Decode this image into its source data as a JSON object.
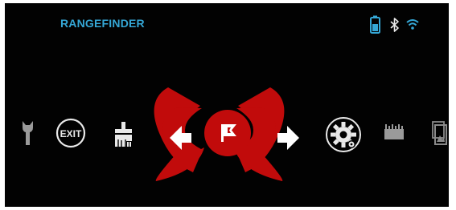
{
  "header": {
    "title": "RANGEFINDER",
    "status_icons": [
      "battery-icon",
      "bluetooth-icon",
      "wifi-icon"
    ]
  },
  "menu": {
    "items": [
      {
        "name": "wrench-icon"
      },
      {
        "name": "exit-button",
        "label": "EXIT"
      },
      {
        "name": "clear-brush-icon"
      },
      {
        "name": "arrow-left-icon"
      },
      {
        "name": "flag-icon",
        "selected": true
      },
      {
        "name": "arrow-right-icon"
      },
      {
        "name": "settings-gear-icon"
      },
      {
        "name": "ruler-icon"
      },
      {
        "name": "gallery-icon"
      }
    ]
  },
  "colors": {
    "background": "#020202",
    "title": "#35a7d6",
    "selection": "#c10b0b",
    "icon": "#e9e9e9",
    "dim_icon": "#9a9a9a"
  }
}
